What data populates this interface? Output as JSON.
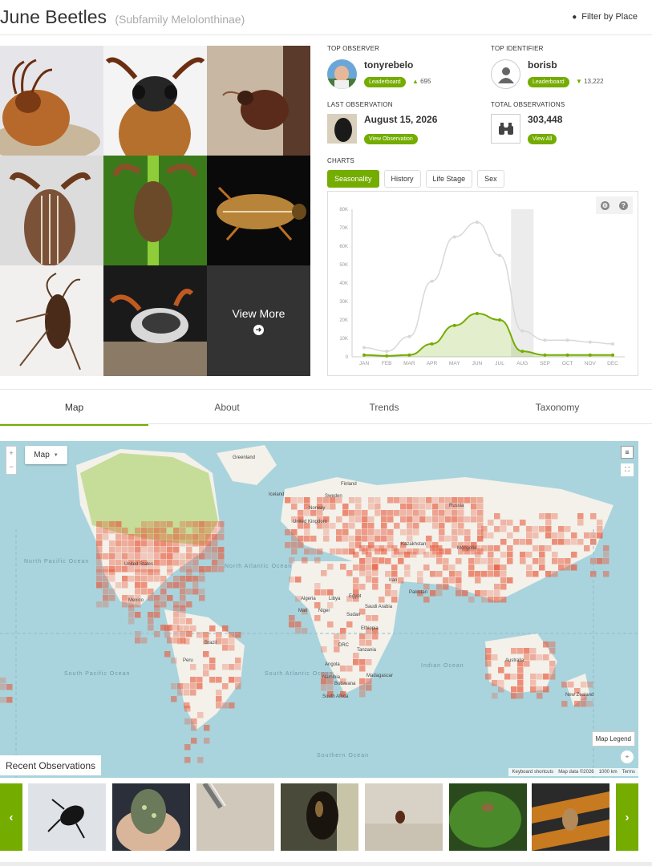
{
  "header": {
    "title": "June Beetles",
    "subtitle": "(Subfamily Melolonthinae)",
    "filter_label": "Filter by Place"
  },
  "gallery": {
    "view_more_label": "View More"
  },
  "stats": {
    "top_observer": {
      "label": "TOP OBSERVER",
      "name": "tonyrebelo",
      "button": "Leaderboard",
      "count": "695"
    },
    "top_identifier": {
      "label": "TOP IDENTIFIER",
      "name": "borisb",
      "button": "Leaderboard",
      "count": "13,222"
    },
    "last_observation": {
      "label": "LAST OBSERVATION",
      "date": "August 15, 2026",
      "button": "View Observation"
    },
    "total_observations": {
      "label": "TOTAL OBSERVATIONS",
      "count": "303,448",
      "button": "View All"
    }
  },
  "charts": {
    "label": "CHARTS",
    "tabs": [
      "Seasonality",
      "History",
      "Life Stage",
      "Sex"
    ],
    "active_tab": 0
  },
  "chart_data": {
    "type": "line",
    "categories": [
      "JAN",
      "FEB",
      "MAR",
      "APR",
      "MAY",
      "JUN",
      "JUL",
      "AUG",
      "SEP",
      "OCT",
      "NOV",
      "DEC"
    ],
    "y_ticks": [
      "0",
      "10K",
      "20K",
      "30K",
      "40K",
      "50K",
      "60K",
      "70K",
      "80K"
    ],
    "ylim": [
      0,
      80000
    ],
    "highlight_category": "AUG",
    "series": [
      {
        "values": [
          5000,
          3000,
          11000,
          41000,
          65000,
          73000,
          55000,
          14000,
          9000,
          9000,
          8000,
          7000
        ],
        "color": "#d8d8d8"
      },
      {
        "values": [
          1000,
          500,
          1000,
          7000,
          17000,
          23500,
          20000,
          3000,
          1000,
          1000,
          1000,
          1000
        ],
        "color": "#74ac00"
      }
    ]
  },
  "section_tabs": [
    "Map",
    "About",
    "Trends",
    "Taxonomy"
  ],
  "map": {
    "type_label": "Map",
    "zoom_in": "+",
    "zoom_out": "−",
    "legend_label": "Map Legend",
    "attrib": [
      "Keyboard shortcuts",
      "Map data ©2026",
      "1000 km",
      "Terms"
    ],
    "places": [
      "Greenland",
      "Iceland",
      "Finland",
      "Sweden",
      "Norway",
      "Russia",
      "United Kingdom",
      "Kazakhstan",
      "Mongolia",
      "North Pacific Ocean",
      "North Atlantic Ocean",
      "United States",
      "Mexico",
      "Algeria",
      "Libya",
      "Egypt",
      "Mali",
      "Niger",
      "Sudan",
      "Ethiopia",
      "Saudi Arabia",
      "Iran",
      "Pakistan",
      "DRC",
      "Tanzania",
      "Angola",
      "Namibia",
      "Botswana",
      "Madagascar",
      "South Africa",
      "South Pacific Ocean",
      "South Atlantic Ocean",
      "Indian Ocean",
      "Australia",
      "New Zealand",
      "Southern Ocean",
      "Brazil",
      "Peru"
    ]
  },
  "recent": {
    "label": "Recent Observations",
    "prev": "‹",
    "next": "›"
  },
  "colors": {
    "accent": "#74ac00",
    "range": "#e8583a",
    "map_water": "#a9d4dd"
  }
}
